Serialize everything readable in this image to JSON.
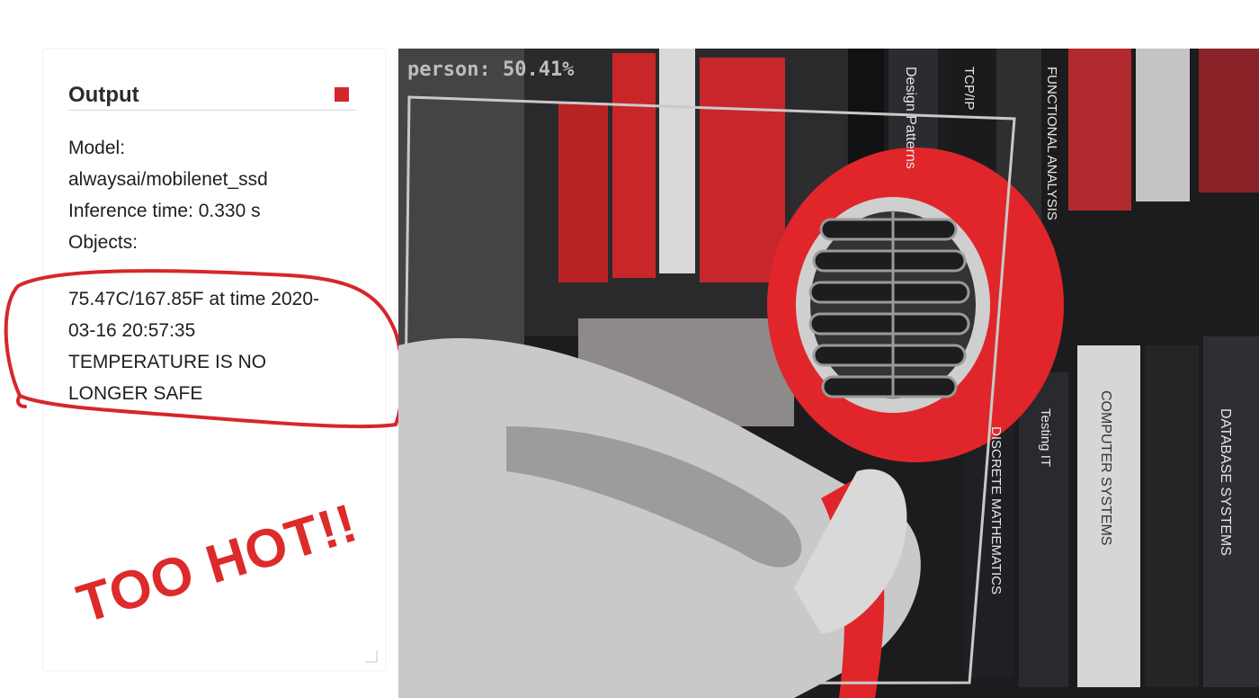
{
  "panel": {
    "title": "Output",
    "model_label": "Model:",
    "model_value": "alwaysai/mobilenet_ssd",
    "inference": "Inference time: 0.330 s",
    "objects_label": "Objects:",
    "reading_line1": "75.47C/167.85F at time 2020-",
    "reading_line2": "03-16 20:57:35",
    "alert_line1": "TEMPERATURE IS NO",
    "alert_line2": "LONGER SAFE"
  },
  "annotation": {
    "text": "TOO HOT!!",
    "color": "#dd2a2a"
  },
  "feed": {
    "detection_label": "person: 50.41%",
    "book_titles": [
      "Design Patterns",
      "TCP/IP",
      "FUNCTIONAL ANALYSIS",
      "Testing IT",
      "COMPUTER SYSTEMS",
      "DATABASE SYSTEMS",
      "DISCRETE MATHEMATICS"
    ]
  },
  "colors": {
    "status_red": "#d7262b",
    "hair_dryer_red": "#e0262a",
    "bbox_gray": "#c9c9c9"
  }
}
